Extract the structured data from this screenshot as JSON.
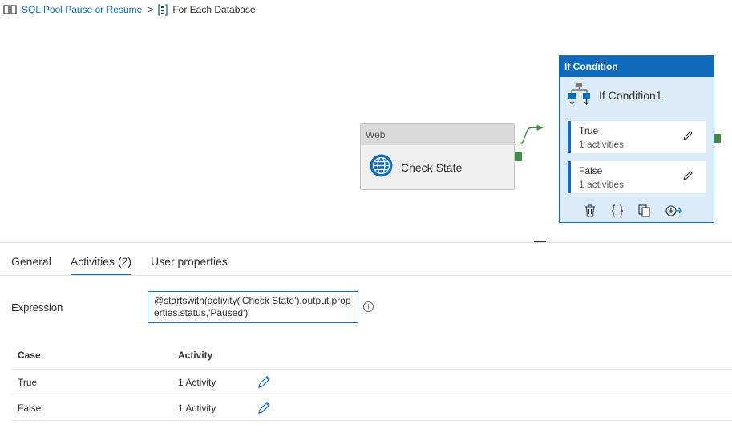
{
  "breadcrumb": {
    "parent": "SQL Pool Pause or Resume",
    "separator": ">",
    "current": "For Each Database"
  },
  "canvas": {
    "web_activity": {
      "type_label": "Web",
      "name": "Check State"
    },
    "if_condition": {
      "type_label": "If Condition",
      "name": "If Condition1",
      "branches": [
        {
          "name": "True",
          "activities": "1 activities"
        },
        {
          "name": "False",
          "activities": "1 activities"
        }
      ],
      "toolbar_icons": [
        "delete-icon",
        "code-braces-icon",
        "copy-icon",
        "add-output-icon"
      ]
    }
  },
  "panel": {
    "tabs": [
      {
        "label": "General",
        "active": false
      },
      {
        "label": "Activities (2)",
        "active": true
      },
      {
        "label": "User properties",
        "active": false
      }
    ],
    "expression": {
      "label": "Expression",
      "value": "@startswith(activity('Check State').output.properties.status,'Paused')"
    },
    "table": {
      "headers": {
        "case": "Case",
        "activity": "Activity"
      },
      "rows": [
        {
          "case": "True",
          "activity": "1 Activity"
        },
        {
          "case": "False",
          "activity": "1 Activity"
        }
      ]
    }
  },
  "colors": {
    "accent": "#0f6cbd",
    "success": "#3c8d40",
    "if_bg": "#dcebf8"
  }
}
